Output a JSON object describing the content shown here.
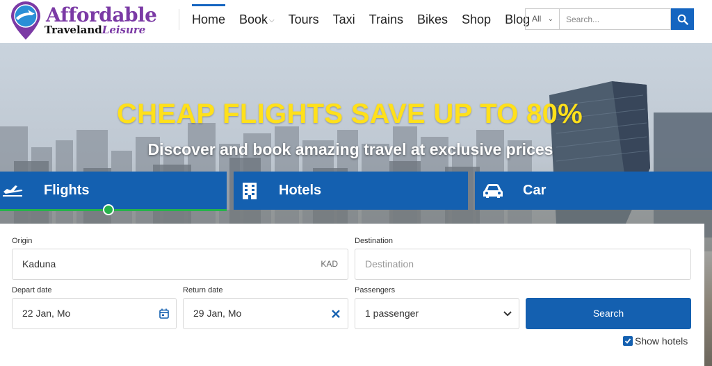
{
  "brand": {
    "name_line1": "Affordable",
    "name_line2_main": "Traveland",
    "name_line2_accent": "Leisure",
    "colors": {
      "brand": "#7b3aa5",
      "primary": "#1460b0",
      "accent_green": "#26b24b",
      "headline_yellow": "#ffe01b"
    }
  },
  "nav": {
    "items": [
      {
        "label": "Home",
        "active": true
      },
      {
        "label": "Book",
        "has_dropdown": true
      },
      {
        "label": "Tours"
      },
      {
        "label": "Taxi"
      },
      {
        "label": "Trains"
      },
      {
        "label": "Bikes"
      },
      {
        "label": "Shop"
      },
      {
        "label": "Blog"
      }
    ]
  },
  "search": {
    "category": "All",
    "placeholder": "Search...",
    "button_icon": "search-icon"
  },
  "hero": {
    "title": "CHEAP FLIGHTS SAVE UP TO 80%",
    "subtitle": "Discover and book amazing travel at exclusive prices"
  },
  "tabs": [
    {
      "label": "Flights",
      "icon": "plane-icon",
      "active": true
    },
    {
      "label": "Hotels",
      "icon": "building-icon"
    },
    {
      "label": "Car",
      "icon": "car-icon"
    }
  ],
  "form": {
    "origin": {
      "label": "Origin",
      "value": "Kaduna",
      "code": "KAD"
    },
    "destination": {
      "label": "Destination",
      "placeholder": "Destination"
    },
    "depart": {
      "label": "Depart date",
      "value": "22 Jan, Mo",
      "icon": "calendar-icon"
    },
    "return": {
      "label": "Return date",
      "value": "29 Jan, Mo",
      "icon": "clear-icon"
    },
    "passengers": {
      "label": "Passengers",
      "value": "1 passenger",
      "icon": "chevron-down-icon"
    },
    "search_button": "Search",
    "show_hotels": {
      "label": "Show hotels",
      "checked": true
    }
  }
}
